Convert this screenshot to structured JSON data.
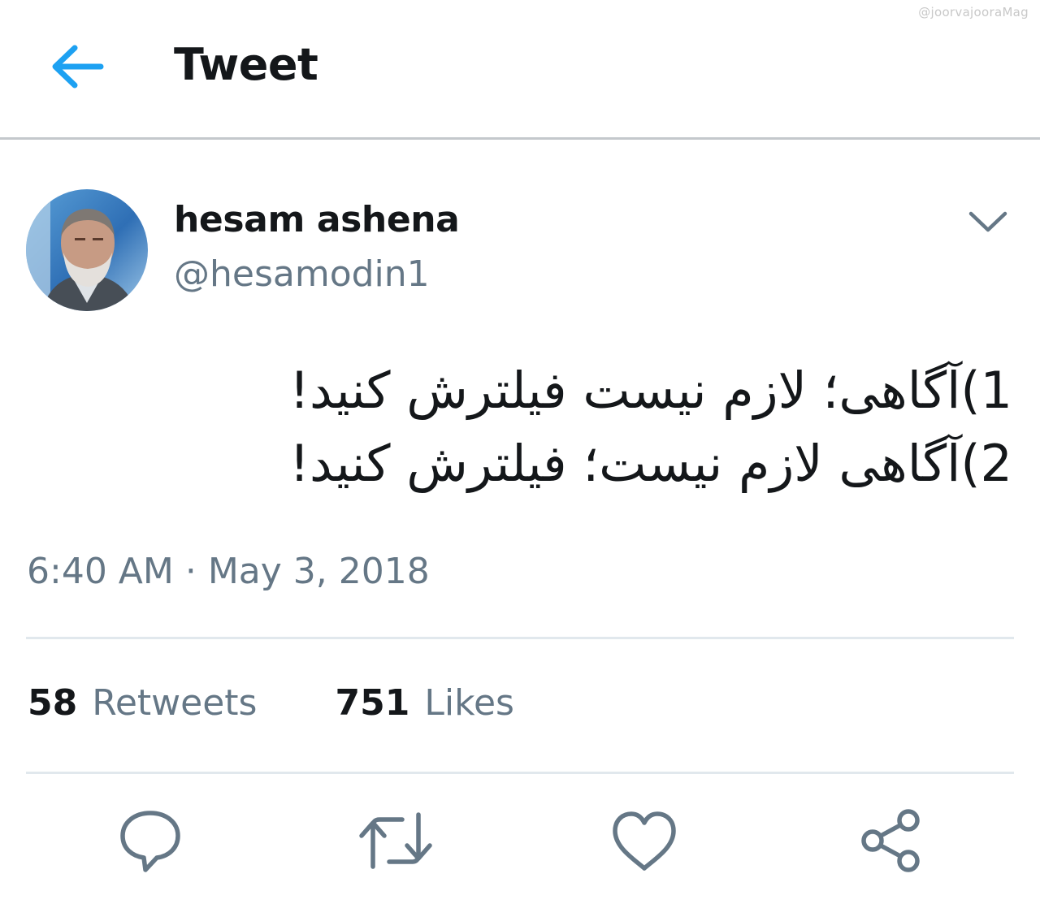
{
  "watermark": "@joorvajooraMag",
  "header": {
    "title": "Tweet",
    "back_icon": "arrow-left-icon",
    "accent_color": "#1da1f2"
  },
  "tweet": {
    "author_name": "hesam ashena",
    "author_handle": "@hesamodin1",
    "avatar_icon": "profile-photo",
    "menu_icon": "chevron-down-icon",
    "lines": [
      "1)آگاهی؛ لازم نیست فیلترش کنید!",
      "2)آگاهی لازم نیست؛ فیلترش کنید!"
    ],
    "timestamp": "6:40 AM · May 3, 2018"
  },
  "stats": {
    "retweets_count": "58",
    "retweets_label": "Retweets",
    "likes_count": "751",
    "likes_label": "Likes"
  },
  "actions": [
    {
      "name": "reply",
      "icon": "speech-bubble-icon"
    },
    {
      "name": "retweet",
      "icon": "retweet-icon"
    },
    {
      "name": "like",
      "icon": "heart-icon"
    },
    {
      "name": "share",
      "icon": "share-icon"
    }
  ],
  "colors": {
    "text_primary": "#14171a",
    "text_secondary": "#657786",
    "divider": "#e1e8ed",
    "icon_gray": "#657786"
  }
}
